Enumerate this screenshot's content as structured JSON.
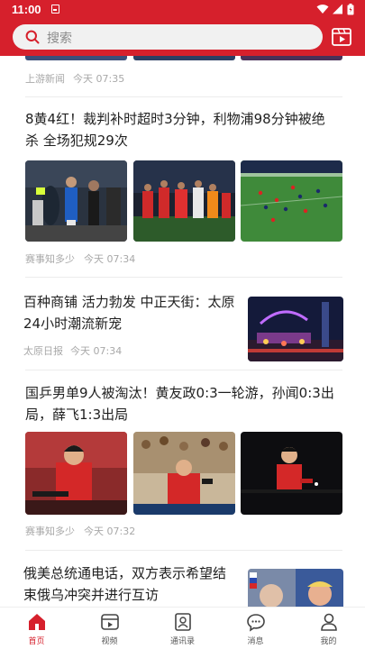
{
  "status_bar": {
    "time": "11:00"
  },
  "search": {
    "placeholder": "搜索"
  },
  "colors": {
    "brand": "#d6202c",
    "muted_text": "#a8a8a8"
  },
  "feed": {
    "items": [
      {
        "source": "上游新闻",
        "time": "今天 07:35"
      },
      {
        "title_line1": "8黄4红！裁判补时超时3分钟，利物浦98分钟被绝",
        "title_line2": "杀 全场犯规29次",
        "source": "赛事知多少",
        "time": "今天 07:34"
      },
      {
        "title_line1": "百种商铺 活力勃发 中正天街：太原",
        "title_line2": "24小时潮流新宠",
        "source": "太原日报",
        "time": "今天 07:34"
      },
      {
        "title_line1": "国乒男单9人被淘汰！黄友政0:3一轮游，孙闻0:3出",
        "title_line2": "局，薛飞1:3出局",
        "source": "赛事知多少",
        "time": "今天 07:32"
      },
      {
        "title_line1": "俄美总统通电话，双方表示希望结",
        "title_line2": "束俄乌冲突并进行互访"
      }
    ]
  },
  "bottom_nav": {
    "items": [
      {
        "label": "首页",
        "icon": "home-icon",
        "active": true
      },
      {
        "label": "视频",
        "icon": "video-icon"
      },
      {
        "label": "通讯录",
        "icon": "contacts-icon"
      },
      {
        "label": "消息",
        "icon": "message-icon"
      },
      {
        "label": "我的",
        "icon": "profile-icon"
      }
    ]
  }
}
